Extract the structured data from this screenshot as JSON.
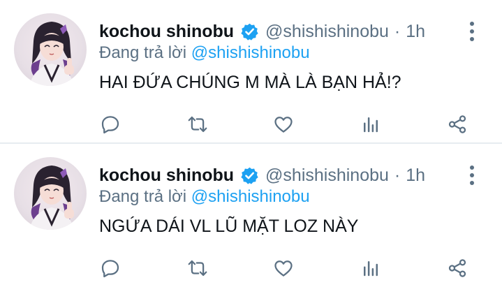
{
  "tweets": [
    {
      "author": {
        "name": "kochou shinobu",
        "handle": "@shishishinobu",
        "avatar_icon": "anime-girl-avatar"
      },
      "time": "1h",
      "separator": "·",
      "reply_prefix": "Đang trả lời",
      "reply_to": "@shishishinobu",
      "text": "HAI ĐỨA CHÚNG M MÀ LÀ BẠN HẢ!?"
    },
    {
      "author": {
        "name": "kochou shinobu",
        "handle": "@shishishinobu",
        "avatar_icon": "anime-girl-avatar"
      },
      "time": "1h",
      "separator": "·",
      "reply_prefix": "Đang trả lời",
      "reply_to": "@shishishinobu",
      "text": "NGỨA DÁI VL LŨ MẶT LOZ NÀY"
    }
  ],
  "actions": [
    "reply-icon",
    "retweet-icon",
    "like-icon",
    "analytics-icon",
    "share-icon"
  ],
  "colors": {
    "accent": "#1da1f2",
    "secondary_text": "#5b7083",
    "icon": "#5b7083",
    "divider": "#e6ecf0",
    "verified": "#1da1f2"
  }
}
